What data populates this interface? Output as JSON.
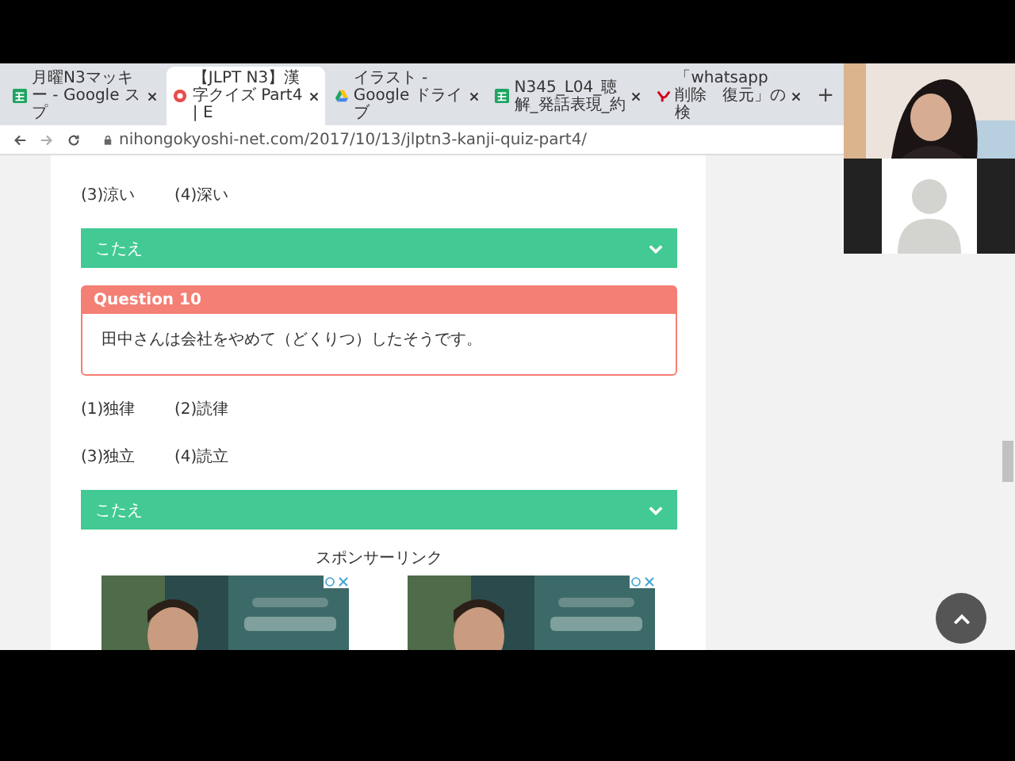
{
  "browser": {
    "tabs": [
      {
        "label": "月曜N3マッキー - Google スプ",
        "kind": "sheets",
        "selected": false
      },
      {
        "label": "【JLPT N3】漢字クイズ Part4 | E",
        "kind": "site",
        "selected": true
      },
      {
        "label": "イラスト - Google ドライブ",
        "kind": "drive",
        "selected": false
      },
      {
        "label": "N345_L04_聴解_発話表現_約",
        "kind": "sheets",
        "selected": false
      },
      {
        "label": "「whatsapp 削除　復元」の検",
        "kind": "yahoo",
        "selected": false
      }
    ],
    "new_tab": "+",
    "address": "nihongokyoshi-net.com/2017/10/13/jlptn3-kanji-quiz-part4/"
  },
  "content": [
    {
      "kind": "options",
      "items": [
        "(3)涼い",
        "(4)深い"
      ]
    },
    {
      "kind": "answer",
      "label": "こたえ",
      "expanded": false
    },
    {
      "kind": "question",
      "title": "Question 10",
      "text": "田中さんは会社をやめて（どくりつ）したそうです。"
    },
    {
      "kind": "options",
      "items": [
        "(1)独律",
        "(2)読律"
      ]
    },
    {
      "kind": "options",
      "items": [
        "(3)独立",
        "(4)読立"
      ]
    },
    {
      "kind": "answer",
      "label": "こたえ",
      "expanded": false
    },
    {
      "kind": "sponsor",
      "label": "スポンサーリンク"
    },
    {
      "kind": "ads"
    }
  ],
  "video_tiles": [
    {
      "kind": "camera"
    },
    {
      "kind": "avatar"
    }
  ]
}
